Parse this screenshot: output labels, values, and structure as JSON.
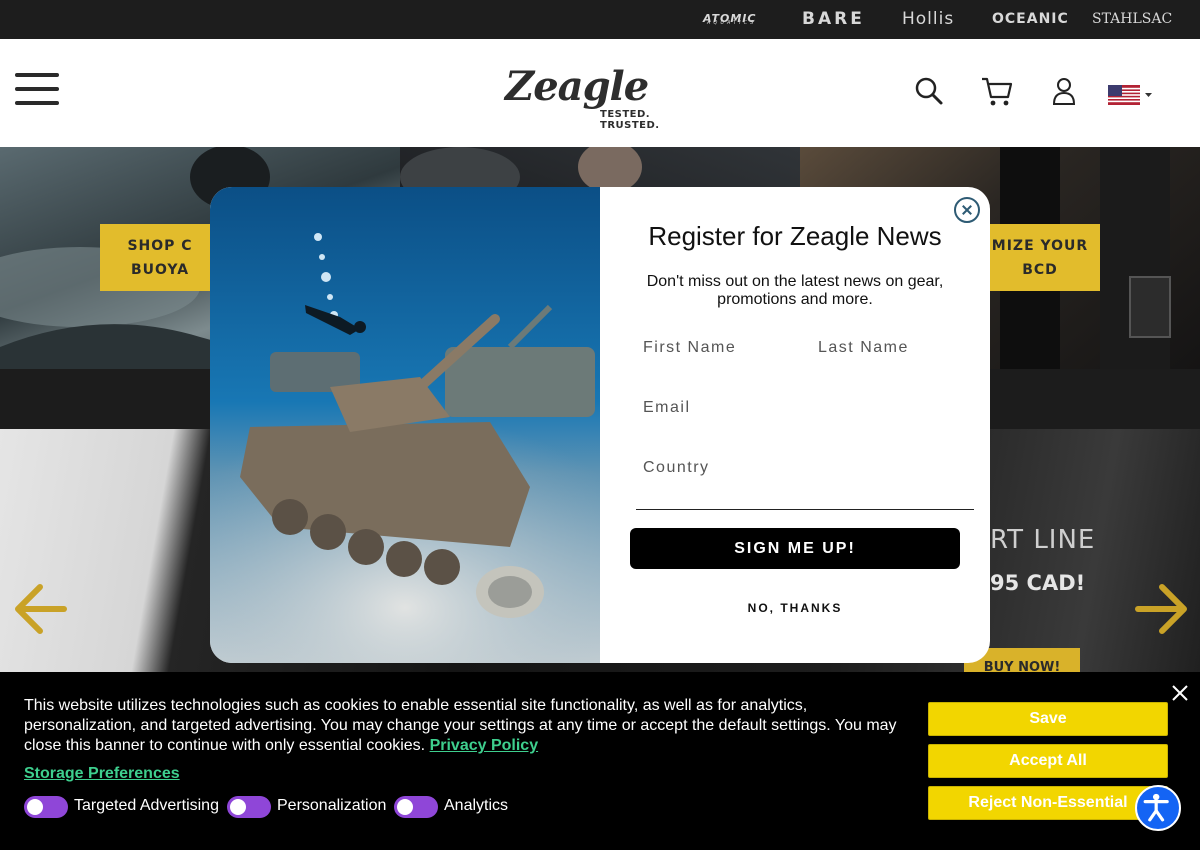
{
  "brands": {
    "atomic": "ATOMIC",
    "atomic_sub": "AQUATICS",
    "bare": "BARE",
    "hollis": "Hollis",
    "oceanic": "OCEANIC",
    "stahlsac": "STAHLSAC"
  },
  "header": {
    "logo_word": "Zeagle",
    "logo_tagline": "TESTED. TRUSTED."
  },
  "background": {
    "tile1_cta": "SHOP C\nBUOYA",
    "tile3_cta": "MIZE YOUR\nBCD",
    "slide_heading": "RT LINE",
    "slide_price": "95 CAD!",
    "slide_cta": "BUY NOW!"
  },
  "modal": {
    "title": "Register for Zeagle News",
    "subtitle": "Don't miss out on the latest news on gear, promotions and more.",
    "first_name_placeholder": "First Name",
    "last_name_placeholder": "Last Name",
    "email_placeholder": "Email",
    "country_placeholder": "Country",
    "signup_label": "SIGN ME UP!",
    "no_thanks_label": "NO, THANKS"
  },
  "cookie": {
    "text": "This website utilizes technologies such as cookies to enable essential site functionality, as well as for analytics, personalization, and targeted advertising. You may change your settings at any time or accept the default settings. You may close this banner to continue with only essential cookies.",
    "privacy_link": "Privacy Policy",
    "storage_link": "Storage Preferences",
    "toggles": [
      "Targeted Advertising",
      "Personalization",
      "Analytics"
    ],
    "save_label": "Save",
    "accept_label": "Accept All",
    "reject_label": "Reject Non-Essential"
  },
  "colors": {
    "accent_yellow": "#f2d600",
    "toggle_purple": "#8f46d8",
    "link_green": "#3ecf8e",
    "arrow_gold": "#c9a227",
    "a11y_blue": "#1464f4"
  },
  "icons": {
    "menu": "menu-icon",
    "search": "search-icon",
    "cart": "cart-icon",
    "account": "account-icon",
    "flag": "us-flag-icon",
    "close": "close-icon",
    "prev": "arrow-left-icon",
    "next": "arrow-right-icon",
    "accessibility": "accessibility-icon"
  }
}
